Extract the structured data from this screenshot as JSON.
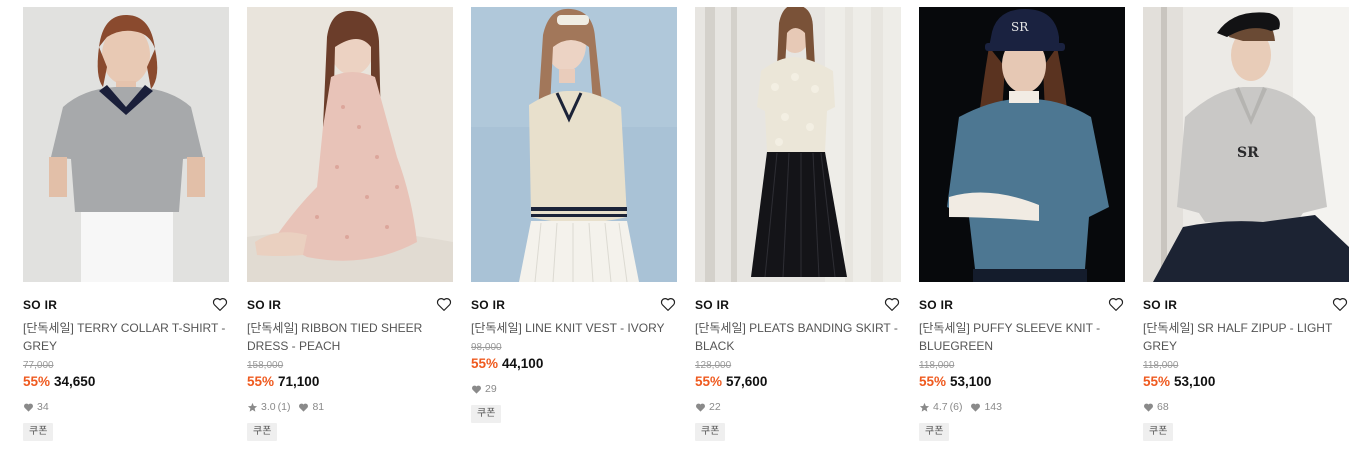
{
  "products": [
    {
      "brand": "SO IR",
      "name": "[단독세일] TERRY COLLAR T-SHIRT - GREY",
      "original_price": "77,000",
      "discount": "55%",
      "sale_price": "34,650",
      "rating": "",
      "review_count": "",
      "likes": "34",
      "badge": "쿠폰"
    },
    {
      "brand": "SO IR",
      "name": "[단독세일] RIBBON TIED SHEER DRESS - PEACH",
      "original_price": "158,000",
      "discount": "55%",
      "sale_price": "71,100",
      "rating": "3.0",
      "review_count": "(1)",
      "likes": "81",
      "badge": "쿠폰"
    },
    {
      "brand": "SO IR",
      "name": "[단독세일] LINE KNIT VEST - IVORY",
      "original_price": "98,000",
      "discount": "55%",
      "sale_price": "44,100",
      "rating": "",
      "review_count": "",
      "likes": "29",
      "badge": "쿠폰"
    },
    {
      "brand": "SO IR",
      "name": "[단독세일] PLEATS BANDING SKIRT - BLACK",
      "original_price": "128,000",
      "discount": "55%",
      "sale_price": "57,600",
      "rating": "",
      "review_count": "",
      "likes": "22",
      "badge": "쿠폰"
    },
    {
      "brand": "SO IR",
      "name": "[단독세일] PUFFY SLEEVE KNIT - BLUEGREEN",
      "original_price": "118,000",
      "discount": "55%",
      "sale_price": "53,100",
      "rating": "4.7",
      "review_count": "(6)",
      "likes": "143",
      "badge": "쿠폰"
    },
    {
      "brand": "SO IR",
      "name": "[단독세일] SR HALF ZIPUP - LIGHT GREY",
      "original_price": "118,000",
      "discount": "55%",
      "sale_price": "53,100",
      "rating": "",
      "review_count": "",
      "likes": "68",
      "badge": "쿠폰"
    }
  ],
  "icons": {
    "wishlist": "heart-outline-icon",
    "like": "heart-filled-icon",
    "rating": "star-icon"
  },
  "colors": {
    "discount": "#ef5a1f",
    "text": "#111111",
    "muted": "#8a8a8a",
    "badge_bg": "#efefef"
  }
}
